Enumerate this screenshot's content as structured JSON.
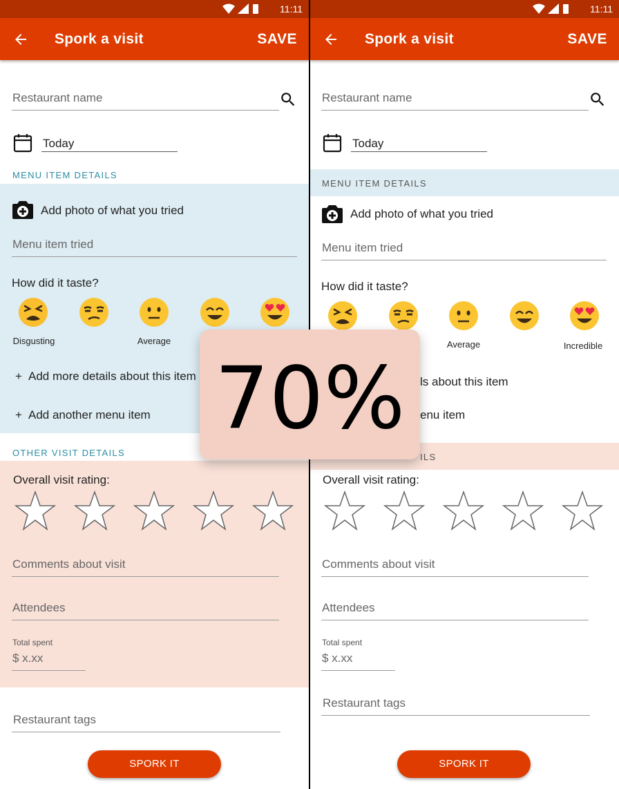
{
  "status": {
    "time": "11:11"
  },
  "appbar": {
    "title": "Spork a visit",
    "save_label": "SAVE"
  },
  "form": {
    "restaurant_placeholder": "Restaurant name",
    "date_value": "Today",
    "menu_section": "MENU ITEM DETAILS",
    "add_photo": "Add photo of what you tried",
    "menu_item_placeholder": "Menu item tried",
    "taste_question": "How did it taste?",
    "emoji_labels": [
      "Disgusting",
      "Average",
      "Incredible"
    ],
    "add_details": "Add more details about this item",
    "add_another": "Add another menu item",
    "add_details_partial": "ls about this item",
    "add_another_partial": "enu item",
    "other_section": "OTHER VISIT DETAILS",
    "other_section_partial": "ILS",
    "rating_label": "Overall visit rating:",
    "rating_value": 0,
    "rating_max": 5,
    "comments_placeholder": "Comments about visit",
    "attendees_placeholder": "Attendees",
    "total_label": "Total spent",
    "total_placeholder": "$ x.xx",
    "tags_placeholder": "Restaurant tags",
    "submit_label": "SPORK IT"
  },
  "overlay": {
    "text": "70%"
  },
  "colors": {
    "primary": "#de3c00",
    "statusbar": "#b23000",
    "menu_band": "#deedf4",
    "other_band": "#f9e1d8",
    "section_text": "#2a8da3"
  },
  "icons": [
    "back-arrow-icon",
    "search-icon",
    "calendar-icon",
    "camera-add-icon",
    "plus-icon",
    "star-outline-icon",
    "wifi-icon",
    "signal-icon",
    "battery-icon"
  ]
}
